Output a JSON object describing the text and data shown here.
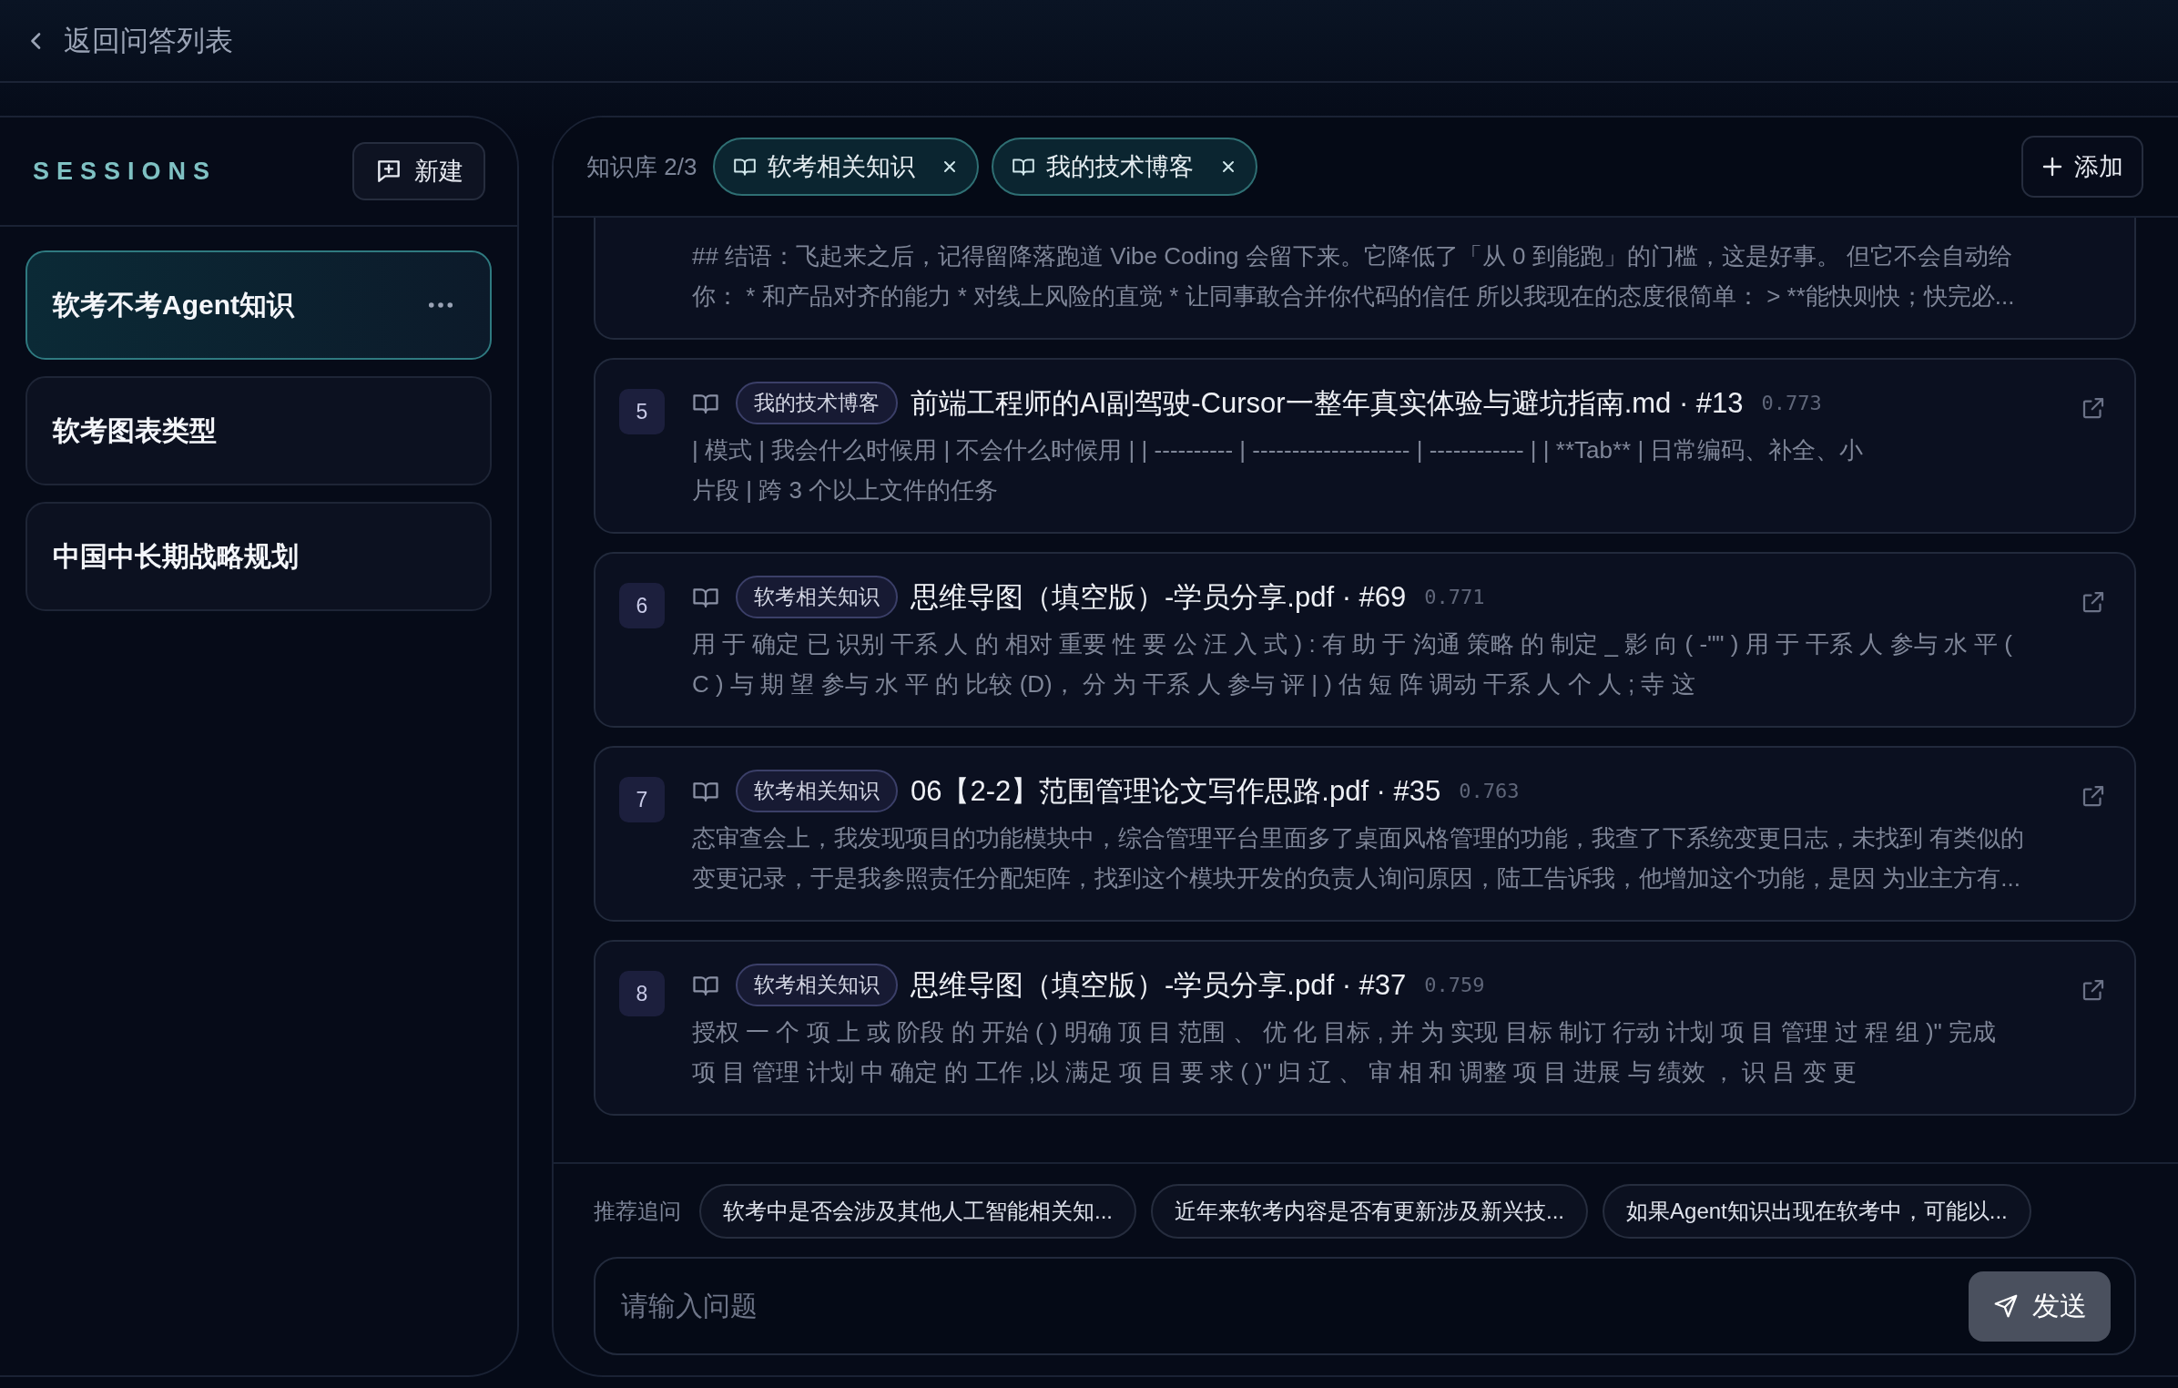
{
  "header": {
    "back_label": "返回问答列表"
  },
  "sidebar": {
    "title": "SESSIONS",
    "new_button": "新建",
    "sessions": [
      {
        "title": "软考不考Agent知识",
        "selected": true
      },
      {
        "title": "软考图表类型",
        "selected": false
      },
      {
        "title": "中国中长期战略规划",
        "selected": false
      }
    ]
  },
  "toolbar": {
    "label": "知识库 2/3",
    "knowledge_bases": [
      {
        "name": "软考相关知识"
      },
      {
        "name": "我的技术博客"
      }
    ],
    "add_button": "添加"
  },
  "results": [
    {
      "snippet_lines": [
        "## 结语：飞起来之后，记得留降落跑道 Vibe Coding 会留下来。它降低了「从 0 到能跑」的门槛，这是好事。 但它不会自动给",
        "你： * 和产品对齐的能力 * 对线上风险的直觉 * 让同事敢合并你代码的信任 所以我现在的态度很简单： > **能快则快；快完必..."
      ]
    },
    {
      "number": "5",
      "tag": "我的技术博客",
      "title": "前端工程师的AI副驾驶-Cursor一整年真实体验与避坑指南.md · #13",
      "score": "0.773",
      "snippet_lines": [
        "| 模式 | 我会什么时候用 | 不会什么时候用 | | ---------- | -------------------- | ------------ | | **Tab** | 日常编码、补全、小",
        "片段 | 跨 3 个以上文件的任务"
      ]
    },
    {
      "number": "6",
      "tag": "软考相关知识",
      "title": "思维导图（填空版）-学员分享.pdf · #69",
      "score": "0.771",
      "snippet_lines": [
        "用 于 确定 已 识别 干系 人 的 相对 重要 性 要 公 汪 入 式 ) : 有 助 于 沟通 策略 的 制定 _ 影 向 ( -\"\" ) 用 于 干系 人 参与 水 平 (",
        "C ) 与 期 望 参与 水 平 的 比较 (D)， 分 为 干系 人 参与 评 | ) 估 短 阵 调动 干系 人 个 人 ; 寺 这"
      ]
    },
    {
      "number": "7",
      "tag": "软考相关知识",
      "title": "06【2-2】范围管理论文写作思路.pdf · #35",
      "score": "0.763",
      "snippet_lines": [
        "态审查会上，我发现项目的功能模块中，综合管理平台里面多了桌面风格管理的功能，我查了下系统变更日志，未找到 有类似的",
        "变更记录，于是我参照责任分配矩阵，找到这个模块开发的负责人询问原因，陆工告诉我，他增加这个功能，是因 为业主方有..."
      ]
    },
    {
      "number": "8",
      "tag": "软考相关知识",
      "title": "思维导图（填空版）-学员分享.pdf · #37",
      "score": "0.759",
      "snippet_lines": [
        "授权 一 个 项 上 或 阶段 的 开始 ( ) 明确 顶 目 范围 、 优 化 目标 , 并 为 实现 目标 制订 行动 计划 项 目 管理 过 程 组 )\" 完成",
        "项 目 管理 计划 中 确定 的 工作 ,以 满足 项 目 要 求 ( )\" 归 辽 、 审 相 和 调整 项 目 进展 与 绩效 ， 识 吕 变 更"
      ]
    }
  ],
  "suggestions": {
    "label": "推荐追问",
    "items": [
      "软考中是否会涉及其他人工智能相关知...",
      "近年来软考内容是否有更新涉及新兴技...",
      "如果Agent知识出现在软考中，可能以..."
    ]
  },
  "composer": {
    "placeholder": "请输入问题",
    "send_button": "发送"
  }
}
